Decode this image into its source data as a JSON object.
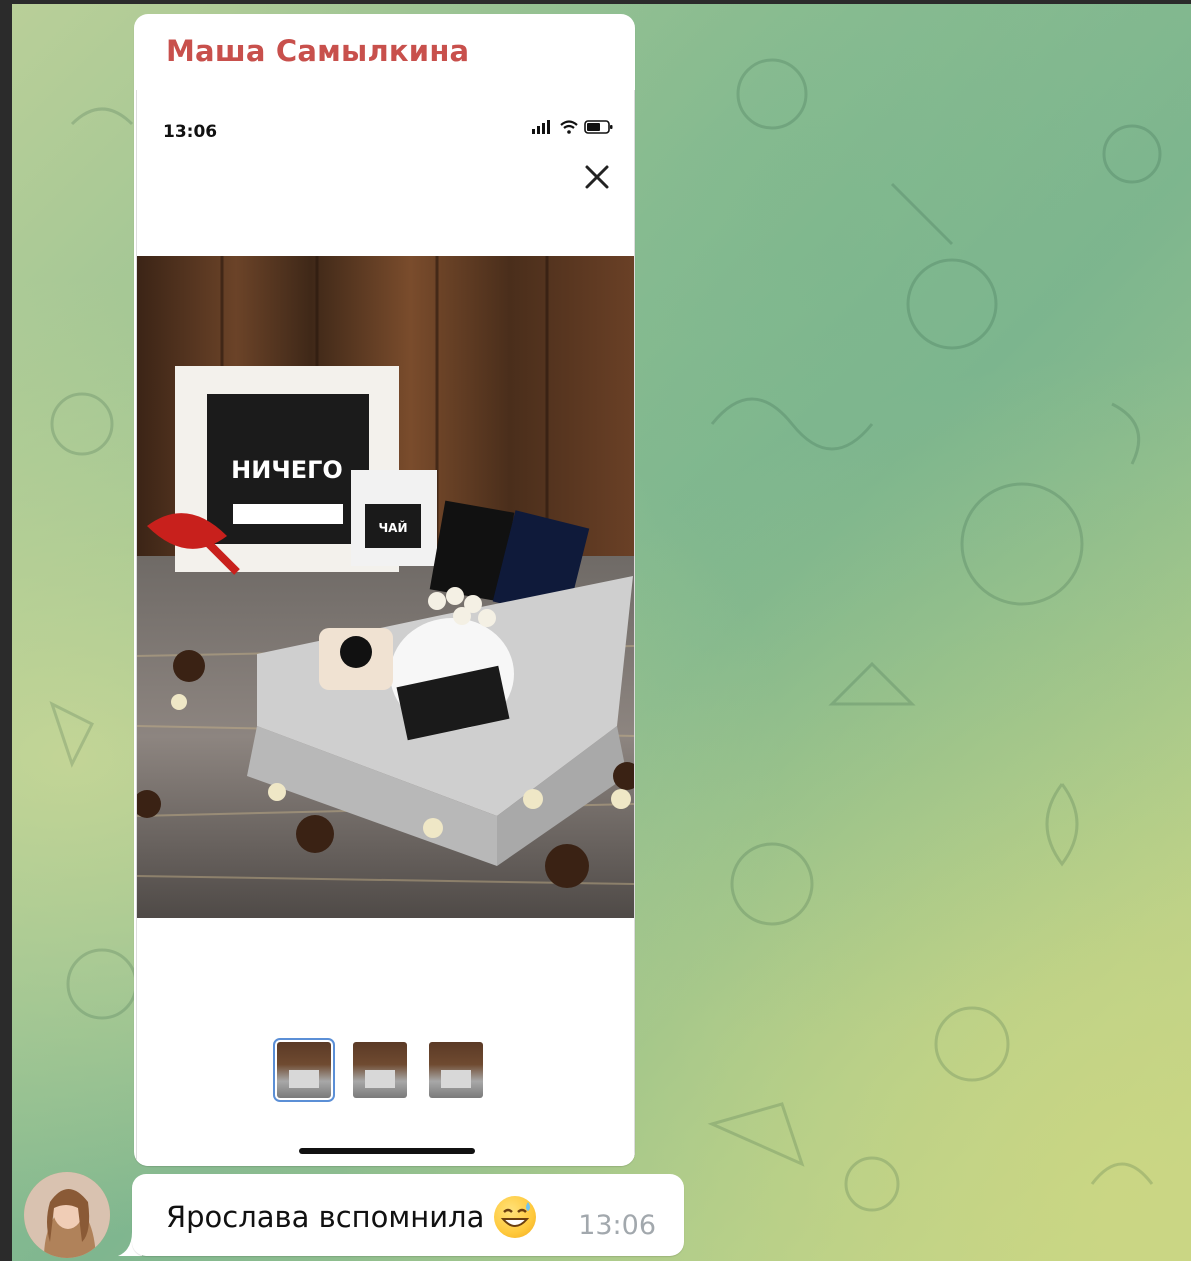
{
  "message_photo": {
    "sender_name": "Маша Самылкина",
    "screenshot": {
      "status_time": "13:06",
      "product_label_main": "НИЧЕГО",
      "product_label_tea": "ЧАЙ",
      "thumbnails": [
        {
          "name": "thumbnail-1",
          "active": true
        },
        {
          "name": "thumbnail-2",
          "active": false
        },
        {
          "name": "thumbnail-3",
          "active": false
        }
      ]
    }
  },
  "message_text": {
    "text": "Ярослава вспомнила",
    "time": "13:06"
  },
  "colors": {
    "sender_name": "#c8504c",
    "active_thumb_outline": "#5b8fd6",
    "time_text": "#a2a8ad"
  }
}
